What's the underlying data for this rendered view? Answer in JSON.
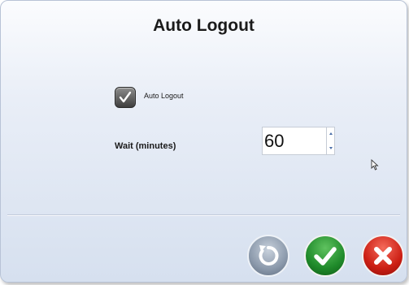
{
  "dialog": {
    "title": "Auto Logout",
    "auto_logout_checkbox": {
      "label": "Auto Logout",
      "checked": true
    },
    "wait": {
      "label": "Wait (minutes)",
      "value": "60"
    },
    "buttons": {
      "reset_icon": "reset-icon",
      "ok_icon": "checkmark-icon",
      "cancel_icon": "close-x-icon"
    },
    "colors": {
      "ok": "#1f8a2a",
      "cancel": "#cc1f14",
      "reset": "#8b99ab"
    }
  }
}
